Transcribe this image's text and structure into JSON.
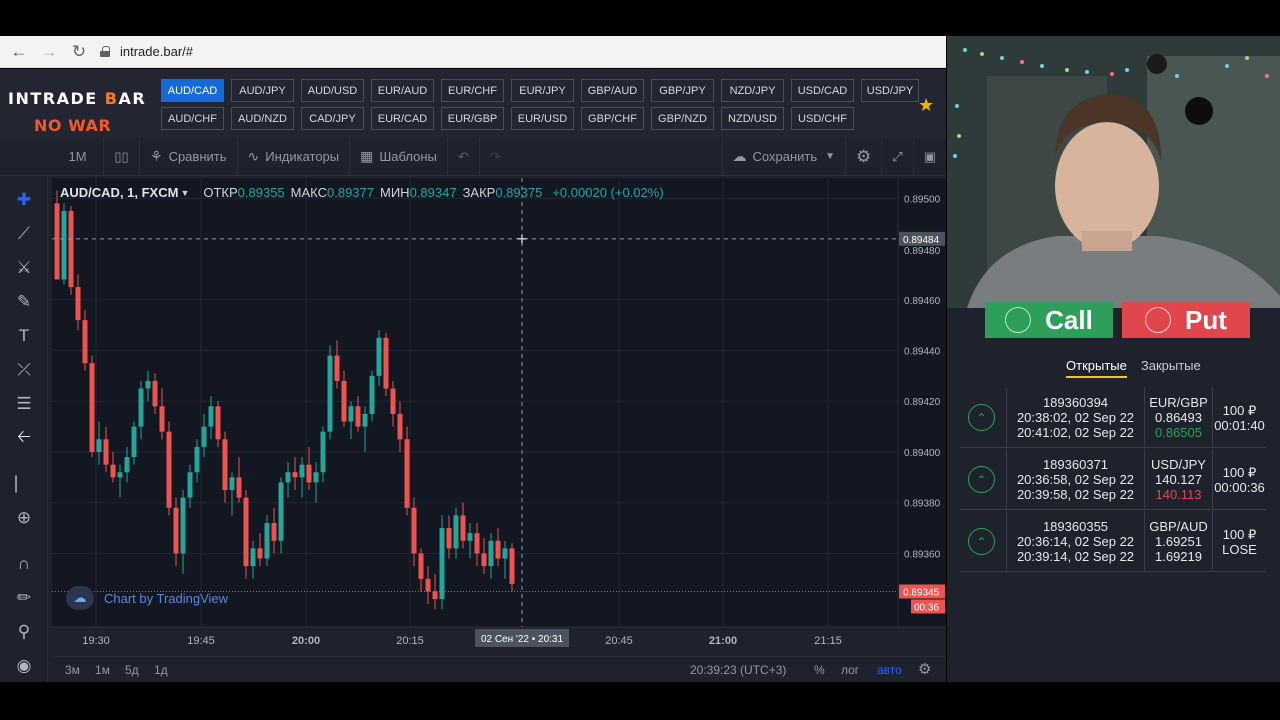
{
  "browser": {
    "url": "intrade.bar/#"
  },
  "site": {
    "logo_main": "INTRADE ",
    "logo_accent": "B",
    "logo_tail": "AR",
    "banner": "NO WAR",
    "pairs_row1": [
      "AUD/CAD",
      "AUD/JPY",
      "AUD/USD",
      "EUR/AUD",
      "EUR/CHF",
      "EUR/JPY",
      "GBP/AUD",
      "GBP/JPY",
      "NZD/JPY",
      "USD/CAD",
      "USD/JPY"
    ],
    "pairs_row2": [
      "AUD/CHF",
      "AUD/NZD",
      "CAD/JPY",
      "EUR/CAD",
      "EUR/GBP",
      "EUR/USD",
      "GBP/CHF",
      "GBP/NZD",
      "NZD/USD",
      "USD/CHF"
    ],
    "active_pair": "AUD/CAD"
  },
  "toolbar": {
    "interval": "1M",
    "compare": "Сравнить",
    "indicators": "Индикаторы",
    "templates": "Шаблоны",
    "save": "Сохранить"
  },
  "legend": {
    "symbol": "AUD/CAD, 1, FXCM",
    "open_label": "ОТКР",
    "open": "0.89355",
    "high_label": "МАКС",
    "high": "0.89377",
    "low_label": "МИН",
    "low": "0.89347",
    "close_label": "ЗАКР",
    "close": "0.89375",
    "change": "+0.00020 (+0.02%)"
  },
  "watermark": "Chart by TradingView",
  "chart_data": {
    "type": "candlestick",
    "y_ticks": [
      "0.89500",
      "0.89460",
      "0.89440",
      "0.89420",
      "0.89400",
      "0.89380",
      "0.89360"
    ],
    "x_ticks": [
      "19:30",
      "19:45",
      "20:00",
      "20:15",
      "20:45",
      "21:00",
      "21:15"
    ],
    "x_ticks_bold": [
      "20:00",
      "21:00"
    ],
    "crosshair_price": "0.89484",
    "crosshair_price_behind": "0.89480",
    "crosshair_time": "02 Сен '22 • 20:31",
    "last_price": "0.89345",
    "countdown": "00:36",
    "ylim": [
      0.89331,
      0.89508
    ],
    "candles": [
      [
        0.89498,
        0.89503,
        0.8947,
        0.89468
      ],
      [
        0.89468,
        0.89498,
        0.89466,
        0.89495
      ],
      [
        0.89495,
        0.89497,
        0.89462,
        0.89465
      ],
      [
        0.89465,
        0.8947,
        0.89448,
        0.89452
      ],
      [
        0.89452,
        0.89456,
        0.89432,
        0.89435
      ],
      [
        0.89435,
        0.89438,
        0.89398,
        0.894
      ],
      [
        0.894,
        0.89412,
        0.89395,
        0.89405
      ],
      [
        0.89405,
        0.8941,
        0.89392,
        0.89395
      ],
      [
        0.89395,
        0.894,
        0.89388,
        0.8939
      ],
      [
        0.8939,
        0.89395,
        0.89382,
        0.89392
      ],
      [
        0.89392,
        0.89402,
        0.89388,
        0.89398
      ],
      [
        0.89398,
        0.89412,
        0.89395,
        0.8941
      ],
      [
        0.8941,
        0.89428,
        0.89405,
        0.89425
      ],
      [
        0.89425,
        0.89432,
        0.8942,
        0.89428
      ],
      [
        0.89428,
        0.89431,
        0.89415,
        0.89418
      ],
      [
        0.89418,
        0.89425,
        0.89405,
        0.89408
      ],
      [
        0.89408,
        0.89412,
        0.89375,
        0.89378
      ],
      [
        0.89378,
        0.89382,
        0.89355,
        0.8936
      ],
      [
        0.8936,
        0.89385,
        0.89352,
        0.89382
      ],
      [
        0.89382,
        0.89395,
        0.89378,
        0.89392
      ],
      [
        0.89392,
        0.89405,
        0.89388,
        0.89402
      ],
      [
        0.89402,
        0.89415,
        0.89398,
        0.8941
      ],
      [
        0.8941,
        0.89422,
        0.89405,
        0.89418
      ],
      [
        0.89418,
        0.8942,
        0.89402,
        0.89405
      ],
      [
        0.89405,
        0.89408,
        0.8938,
        0.89385
      ],
      [
        0.89385,
        0.89392,
        0.89375,
        0.8939
      ],
      [
        0.8939,
        0.89398,
        0.8938,
        0.89382
      ],
      [
        0.89382,
        0.89385,
        0.8935,
        0.89355
      ],
      [
        0.89355,
        0.89365,
        0.8935,
        0.89362
      ],
      [
        0.89362,
        0.89368,
        0.89355,
        0.89358
      ],
      [
        0.89358,
        0.89375,
        0.89355,
        0.89372
      ],
      [
        0.89372,
        0.89378,
        0.8936,
        0.89365
      ],
      [
        0.89365,
        0.8939,
        0.8936,
        0.89388
      ],
      [
        0.89388,
        0.89396,
        0.89382,
        0.89392
      ],
      [
        0.89392,
        0.89398,
        0.89385,
        0.8939
      ],
      [
        0.8939,
        0.89398,
        0.89382,
        0.89395
      ],
      [
        0.89395,
        0.89402,
        0.89385,
        0.89388
      ],
      [
        0.89388,
        0.89396,
        0.8938,
        0.89392
      ],
      [
        0.89392,
        0.8941,
        0.89388,
        0.89408
      ],
      [
        0.89408,
        0.89442,
        0.89405,
        0.89438
      ],
      [
        0.89438,
        0.89444,
        0.89425,
        0.89428
      ],
      [
        0.89428,
        0.89432,
        0.8941,
        0.89412
      ],
      [
        0.89412,
        0.8942,
        0.89405,
        0.89418
      ],
      [
        0.89418,
        0.89422,
        0.89408,
        0.8941
      ],
      [
        0.8941,
        0.89418,
        0.894,
        0.89415
      ],
      [
        0.89415,
        0.89432,
        0.89412,
        0.8943
      ],
      [
        0.8943,
        0.89448,
        0.89426,
        0.89445
      ],
      [
        0.89445,
        0.89447,
        0.89422,
        0.89425
      ],
      [
        0.89425,
        0.89428,
        0.8941,
        0.89415
      ],
      [
        0.89415,
        0.8942,
        0.894,
        0.89405
      ],
      [
        0.89405,
        0.8941,
        0.89375,
        0.89378
      ],
      [
        0.89378,
        0.89382,
        0.89355,
        0.8936
      ],
      [
        0.8936,
        0.89362,
        0.89345,
        0.8935
      ],
      [
        0.8935,
        0.89355,
        0.8934,
        0.89345
      ],
      [
        0.89345,
        0.89352,
        0.89338,
        0.89342
      ],
      [
        0.89342,
        0.89375,
        0.89338,
        0.8937
      ],
      [
        0.8937,
        0.89375,
        0.89358,
        0.89362
      ],
      [
        0.89362,
        0.89378,
        0.89358,
        0.89375
      ],
      [
        0.89375,
        0.8938,
        0.89362,
        0.89365
      ],
      [
        0.89365,
        0.89372,
        0.89358,
        0.89368
      ],
      [
        0.89368,
        0.89372,
        0.89355,
        0.8936
      ],
      [
        0.8936,
        0.89366,
        0.89352,
        0.89355
      ],
      [
        0.89355,
        0.89368,
        0.8935,
        0.89365
      ],
      [
        0.89365,
        0.8937,
        0.89355,
        0.89358
      ],
      [
        0.89358,
        0.89365,
        0.8935,
        0.89362
      ],
      [
        0.89362,
        0.89364,
        0.89345,
        0.89348
      ]
    ]
  },
  "bottombar": {
    "ranges": [
      "3м",
      "1м",
      "5д",
      "1д"
    ],
    "time": "20:39:23 (UTC+3)",
    "percent": "%",
    "log": "лог",
    "auto": "авто"
  },
  "trade_panel": {
    "call": "Call",
    "put": "Put",
    "tab_open": "Открытые",
    "tab_closed": "Закрытые",
    "trades": [
      {
        "id": "189360394",
        "open_time": "20:38:02, 02 Sep 22",
        "close_time": "20:41:02, 02 Sep 22",
        "pair": "EUR/GBP",
        "open_price": "0.86493",
        "current_price": "0.86505",
        "current_color": "#2e9e5b",
        "amount": "100 ₽",
        "status": "00:01:40"
      },
      {
        "id": "189360371",
        "open_time": "20:36:58, 02 Sep 22",
        "close_time": "20:39:58, 02 Sep 22",
        "pair": "USD/JPY",
        "open_price": "140.127",
        "current_price": "140.113",
        "current_color": "#e0474c",
        "amount": "100 ₽",
        "status": "00:00:36"
      },
      {
        "id": "189360355",
        "open_time": "20:36:14, 02 Sep 22",
        "close_time": "20:39:14, 02 Sep 22",
        "pair": "GBP/AUD",
        "open_price": "1.69251",
        "current_price": "1.69219",
        "current_color": "#e6e8ee",
        "amount": "100 ₽",
        "status": "LOSE"
      }
    ]
  },
  "colors": {
    "up": "#26a69a",
    "down": "#ef5350",
    "accent": "#1669d8",
    "call": "#2e9e5b",
    "put": "#e0474c"
  }
}
